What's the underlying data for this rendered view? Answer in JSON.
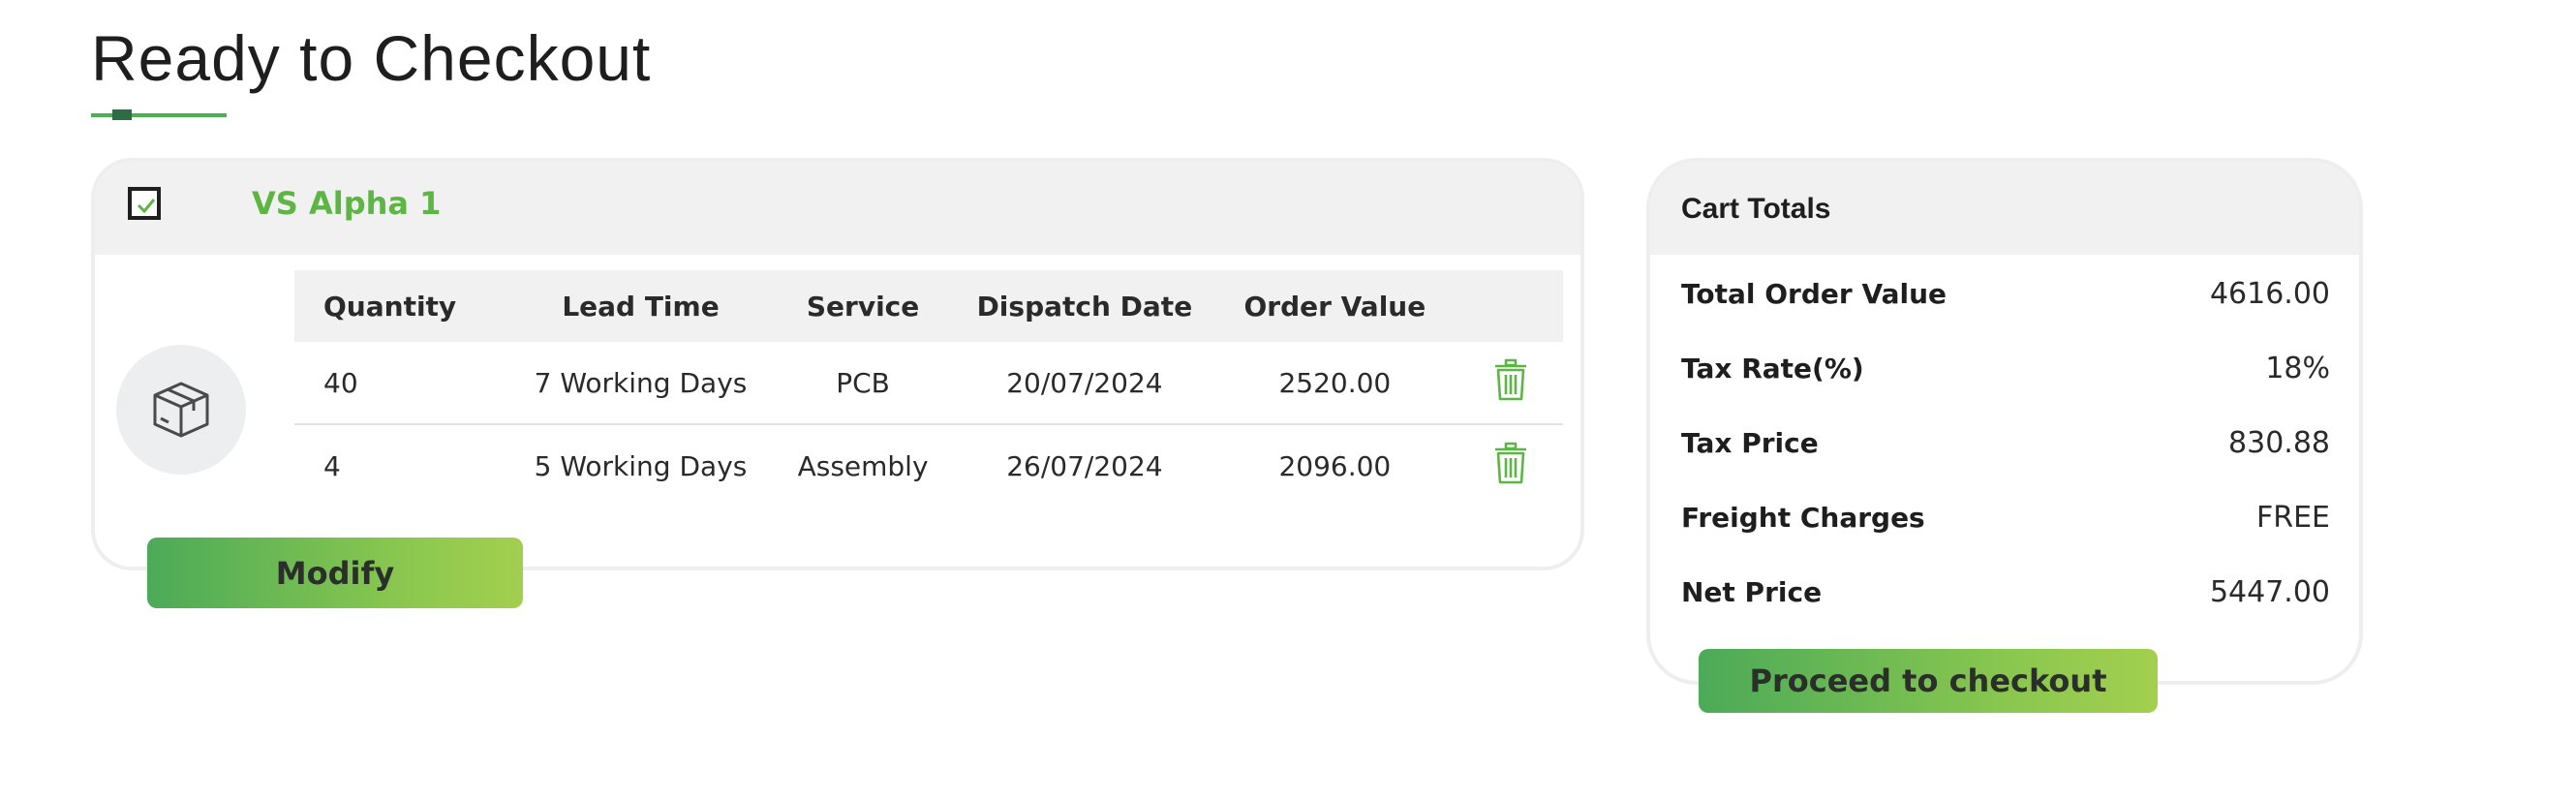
{
  "page": {
    "title": "Ready to Checkout"
  },
  "order": {
    "product_name": "VS Alpha 1",
    "selected": true,
    "columns": [
      "Quantity",
      "Lead Time",
      "Service",
      "Dispatch Date",
      "Order Value"
    ],
    "rows": [
      {
        "quantity": "40",
        "lead_time": "7 Working Days",
        "service": "PCB",
        "dispatch_date": "20/07/2024",
        "order_value": "2520.00"
      },
      {
        "quantity": "4",
        "lead_time": "5 Working Days",
        "service": "Assembly",
        "dispatch_date": "26/07/2024",
        "order_value": "2096.00"
      }
    ],
    "modify_label": "Modify"
  },
  "totals": {
    "title": "Cart Totals",
    "rows": [
      {
        "label": "Total Order Value",
        "value": "4616.00"
      },
      {
        "label": "Tax Rate(%)",
        "value": "18%"
      },
      {
        "label": "Tax Price",
        "value": "830.88"
      },
      {
        "label": "Freight Charges",
        "value": "FREE"
      },
      {
        "label": "Net Price",
        "value": "5447.00"
      }
    ],
    "checkout_label": "Proceed to checkout"
  },
  "icons": {
    "checkbox": "check-icon",
    "product": "box-icon",
    "delete": "trash-icon"
  },
  "colors": {
    "accent_green": "#5db544",
    "button_gradient_start": "#4caa58",
    "button_gradient_end": "#a3cf4f",
    "panel_grey": "#f0f1f0"
  }
}
